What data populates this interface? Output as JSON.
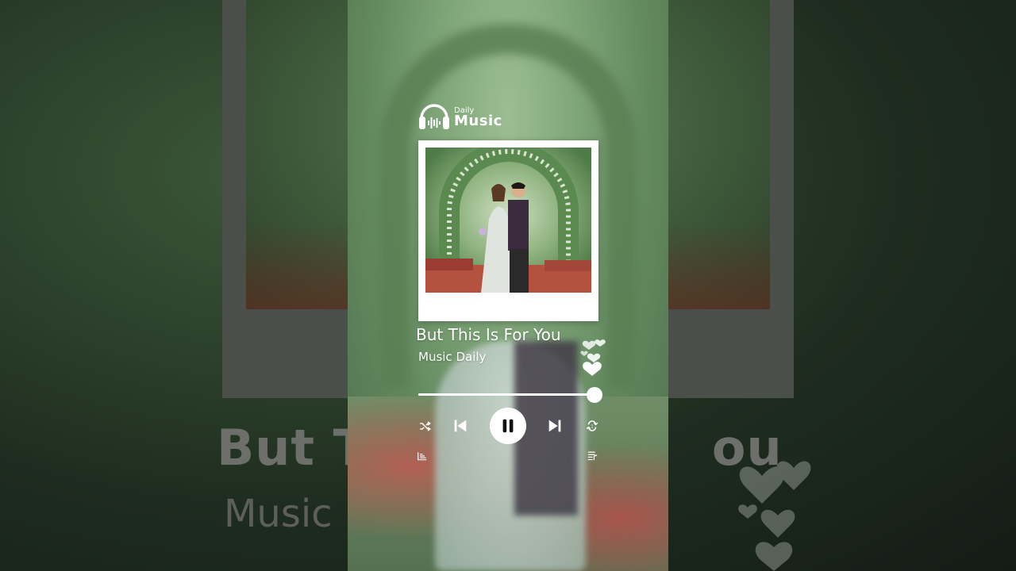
{
  "app": {
    "logo_small": "Daily",
    "logo_big": "Music"
  },
  "track": {
    "title": "But This Is For You",
    "artist": "Music Daily"
  },
  "background": {
    "big_title": "But T",
    "big_title_tail": "ou",
    "big_artist": "Music"
  },
  "player": {
    "progress": 1.0,
    "state": "playing"
  },
  "icons": {
    "logo": "headphones-waveform-icon",
    "shuffle": "shuffle-icon",
    "previous": "skip-previous-icon",
    "pause": "pause-icon",
    "next": "skip-next-icon",
    "repeat": "repeat-one-icon",
    "equalizer": "equalizer-icon",
    "queue": "queue-list-icon",
    "hearts": "floating-hearts-icon"
  },
  "colors": {
    "foreground": "#ffffff",
    "accent": "#ffffff"
  }
}
